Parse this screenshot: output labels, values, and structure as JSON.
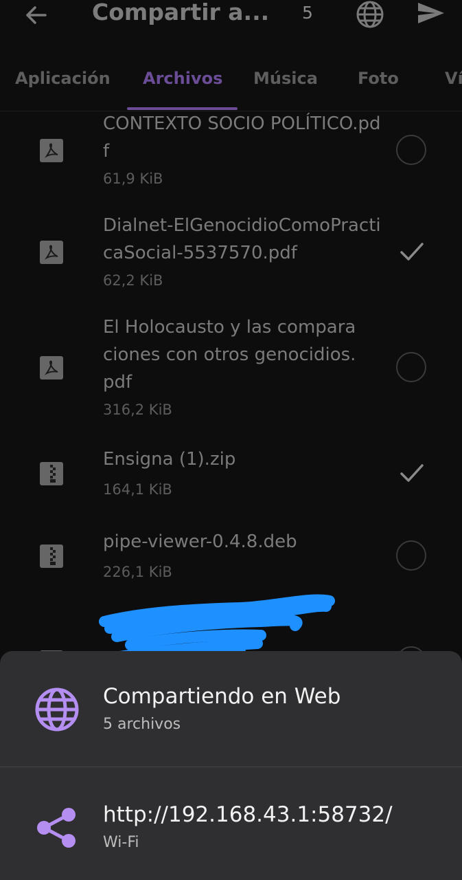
{
  "header": {
    "title": "Compartir a...",
    "selected_count": "5",
    "icons": [
      "back-arrow-icon",
      "globe-icon",
      "send-icon"
    ]
  },
  "tabs": [
    {
      "label": "Aplicación",
      "active": false
    },
    {
      "label": "Archivos",
      "active": true
    },
    {
      "label": "Música",
      "active": false
    },
    {
      "label": "Foto",
      "active": false
    },
    {
      "label": "Ví",
      "active": false
    }
  ],
  "files": [
    {
      "name": "CONTEXTO SOCIO POLÍTICO.pdf",
      "size": "61,9 KiB",
      "type_icon": "pdf-icon",
      "selected": false
    },
    {
      "name": "Dialnet-ElGenocidioComoPracticaSocial-5537570.pdf",
      "size": "62,2 KiB",
      "type_icon": "pdf-icon",
      "selected": true
    },
    {
      "name": "El Holocausto y las comparaciones con otros genocidios.pdf",
      "size": "316,2 KiB",
      "type_icon": "pdf-icon",
      "selected": false
    },
    {
      "name": "Ensigna (1).zip",
      "size": "164,1 KiB",
      "type_icon": "archive-icon",
      "selected": true
    },
    {
      "name": "pipe-viewer-0.4.8.deb",
      "size": "226,1 KiB",
      "type_icon": "archive-icon",
      "selected": false
    }
  ],
  "sheet": {
    "web_title": "Compartiendo en Web",
    "web_subtitle": "5 archivos",
    "url": "http://192.168.43.1:58732/",
    "network": "Wi-Fi"
  },
  "colors": {
    "accent": "#6a4d96",
    "sheet_icon": "#b48ef0",
    "scribble": "#1e90ff",
    "sheet_bg": "#2f2f31"
  }
}
